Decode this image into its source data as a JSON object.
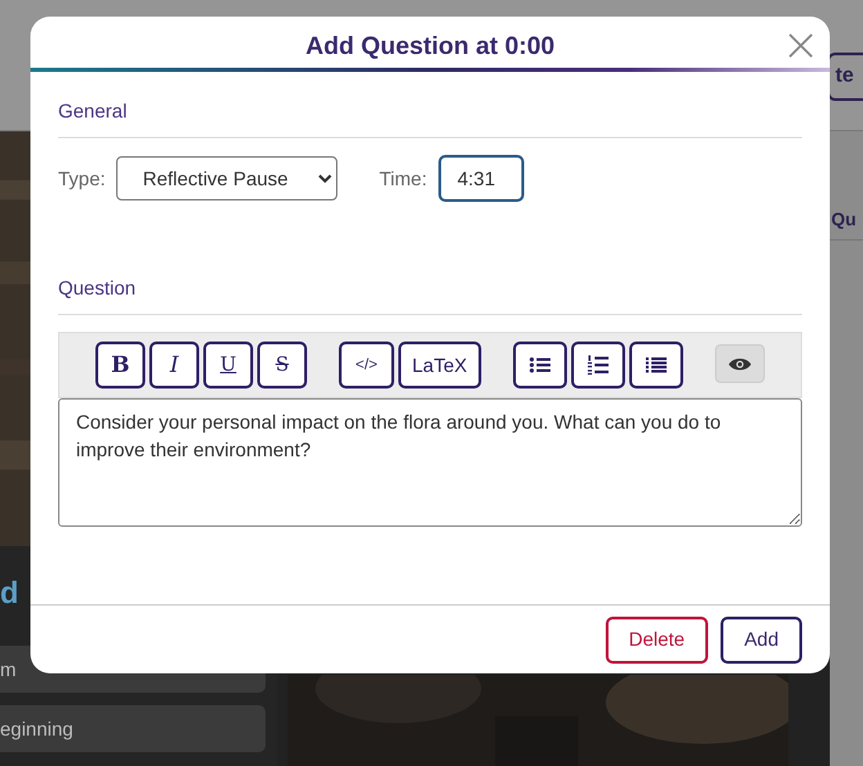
{
  "background": {
    "top_button": "te",
    "side_heading": "Qu",
    "heading": "d",
    "items": [
      {
        "label": "m"
      },
      {
        "label": "eginning"
      }
    ]
  },
  "dialog": {
    "title": "Add Question at 0:00",
    "general": {
      "heading": "General",
      "type_label": "Type:",
      "type_value": "Reflective Pause",
      "time_label": "Time:",
      "time_value": "4:31"
    },
    "question": {
      "heading": "Question",
      "toolbar_groups": [
        [
          {
            "kind": "bold",
            "label": "B"
          },
          {
            "kind": "italic",
            "label": "I"
          },
          {
            "kind": "underline",
            "label": "U"
          },
          {
            "kind": "strike",
            "label": "S"
          }
        ],
        [
          {
            "kind": "code",
            "label": "</>"
          },
          {
            "kind": "text",
            "label": "LaTeX"
          }
        ],
        [
          {
            "kind": "bullets"
          },
          {
            "kind": "numbers"
          },
          {
            "kind": "lines"
          }
        ],
        [
          {
            "kind": "preview"
          }
        ]
      ],
      "text": "Consider your personal impact on the flora around you. What can you do to improve their environment?"
    },
    "buttons": [
      {
        "kind": "danger",
        "label": "Delete"
      },
      {
        "kind": "primary",
        "label": "Add"
      }
    ]
  }
}
